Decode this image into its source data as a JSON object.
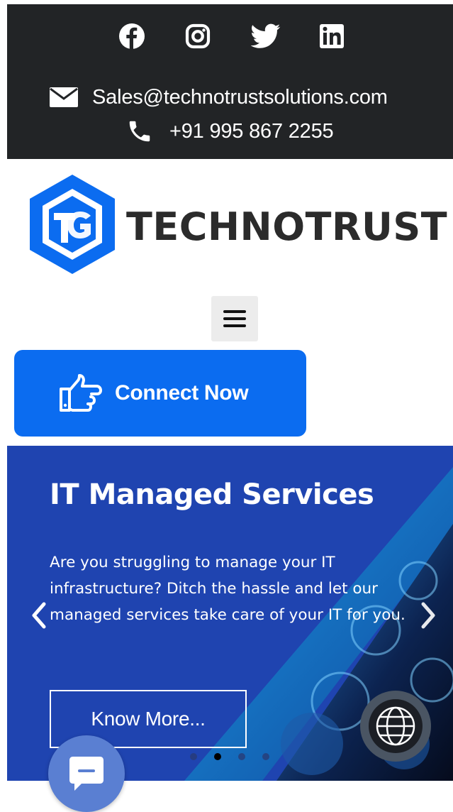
{
  "topbar": {
    "social": [
      "facebook-icon",
      "instagram-icon",
      "twitter-icon",
      "linkedin-icon"
    ],
    "email": "Sales@technotrustsolutions.com",
    "phone": "+91 995 867 2255"
  },
  "logo": {
    "text": "TECHNOTRUST",
    "monogram": "TG"
  },
  "menu": {
    "icon": "hamburger-icon"
  },
  "cta": {
    "label": "Connect Now",
    "icon": "pointing-hand-icon"
  },
  "hero": {
    "title": "IT Managed Services",
    "description": "Are you struggling to manage your IT infrastructure? Ditch the hassle and let our managed services take care of your IT for you.",
    "button_label": "Know More...",
    "slides_count": 4,
    "active_slide": 2
  },
  "colors": {
    "topbar_bg": "#222426",
    "brand_blue": "#0b6cf0",
    "hero_bg": "#1f44b0",
    "chat_bg": "#5a7fd2"
  }
}
